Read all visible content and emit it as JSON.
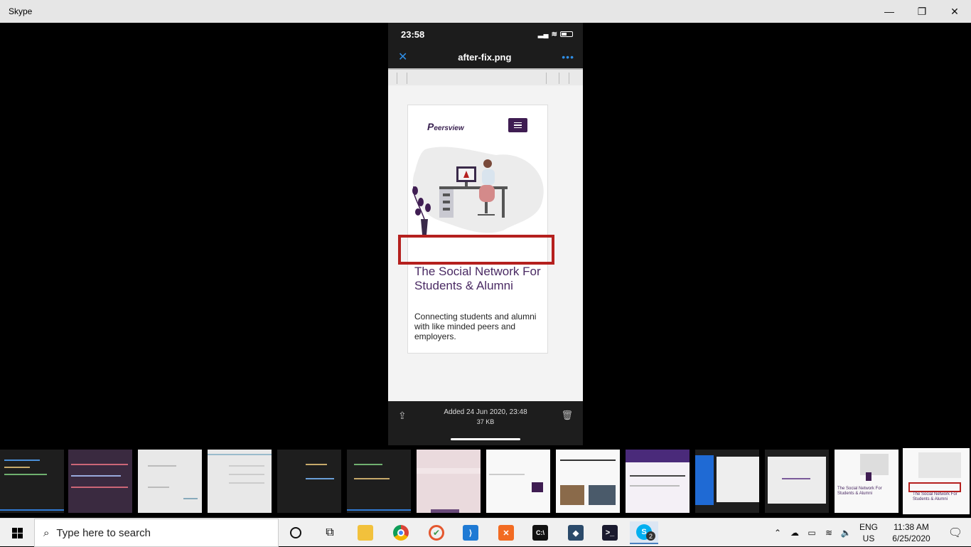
{
  "window": {
    "title": "Skype",
    "minimize": "—",
    "restore": "❐",
    "close": "✕"
  },
  "phone": {
    "time": "23:58",
    "filename": "after-fix.png",
    "close_glyph": "✕",
    "more_glyph": "•••",
    "card": {
      "logo_initial": "P",
      "logo_text": "eersview",
      "hero_title": "The Social Network For Students & Alumni",
      "hero_subtitle": "Connecting students and alumni with like minded peers and employers."
    },
    "footer": {
      "added": "Added 24 Jun 2020, 23:48",
      "size": "37 KB"
    }
  },
  "thumbnails": [
    {
      "style": "dark"
    },
    {
      "style": "dark"
    },
    {
      "style": "light"
    },
    {
      "style": "light"
    },
    {
      "style": "dark"
    },
    {
      "style": "dark"
    },
    {
      "style": "light"
    },
    {
      "style": "white"
    },
    {
      "style": "white"
    },
    {
      "style": "dark"
    },
    {
      "style": "dark"
    },
    {
      "style": "dark"
    },
    {
      "style": "white",
      "text": "The Social Network For Students & Alumni"
    },
    {
      "style": "white",
      "text": "The Social Network For Students & Alumni",
      "selected": true
    }
  ],
  "taskbar": {
    "search_placeholder": "Type here to search",
    "skype_badge": "2",
    "lang_line1": "ENG",
    "lang_line2": "US",
    "time": "11:38 AM",
    "date": "6/25/2020"
  },
  "colors": {
    "accent_purple": "#3f1d52",
    "highlight_red": "#b5201e",
    "ios_blue": "#2f8ee6"
  }
}
